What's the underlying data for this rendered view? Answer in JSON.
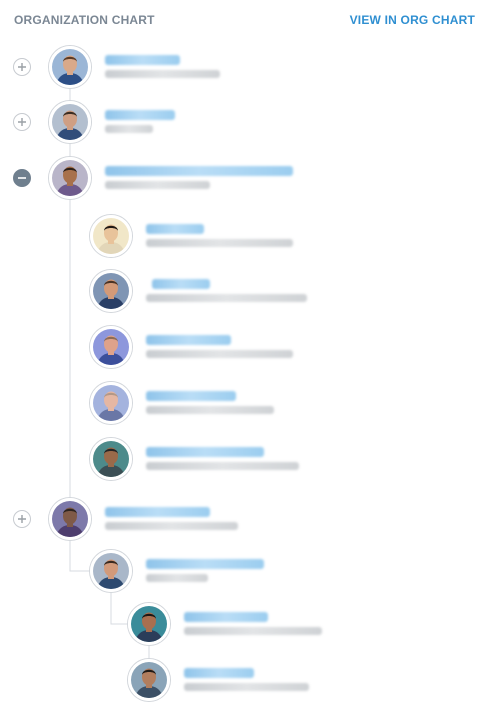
{
  "header": {
    "title": "ORGANIZATION CHART",
    "view_link": "VIEW IN ORG CHART"
  },
  "colors": {
    "accent": "#2f8fd1",
    "muted_text": "#7b8794",
    "connector": "#d7dbe0",
    "collapse_toggle": "#6f7f8e"
  },
  "people": [
    {
      "name": "",
      "title": "",
      "toggle": "plus",
      "skin": "#d9a98a",
      "shirt": "#2d4f86",
      "hair": "#5a3b27",
      "bg": "#9bb6d6"
    },
    {
      "name": "",
      "title": "",
      "toggle": "plus",
      "skin": "#cf9f84",
      "shirt": "#314d7a",
      "hair": "#3b2d22",
      "bg": "#b3bfcf"
    },
    {
      "name": "",
      "title": "",
      "toggle": "minus",
      "skin": "#a8714c",
      "shirt": "#6e5a8c",
      "hair": "#2c1f18",
      "bg": "#b9b5c9"
    },
    {
      "name": "",
      "title": "",
      "toggle": "",
      "skin": "#e8c39a",
      "shirt": "#e2d6b8",
      "hair": "#1f1914",
      "bg": "#f1e7c8"
    },
    {
      "name": "",
      "title": "",
      "toggle": "",
      "skin": "#d39a78",
      "shirt": "#2a3f66",
      "hair": "#4a3426",
      "bg": "#7f95b4"
    },
    {
      "name": "",
      "title": "",
      "toggle": "",
      "skin": "#dfa28a",
      "shirt": "#3c4f9b",
      "hair": "#8d6c56",
      "bg": "#8d97dc"
    },
    {
      "name": "",
      "title": "",
      "toggle": "",
      "skin": "#e5b7a3",
      "shirt": "#6a77a6",
      "hair": "#b49886",
      "bg": "#a4b3de"
    },
    {
      "name": "",
      "title": "",
      "toggle": "",
      "skin": "#9a6a4a",
      "shirt": "#3b4f55",
      "hair": "#252525",
      "bg": "#4d8b8b"
    },
    {
      "name": "",
      "title": "",
      "toggle": "plus",
      "skin": "#7f5a48",
      "shirt": "#4e3e6e",
      "hair": "#2d2420",
      "bg": "#7d79aa"
    },
    {
      "name": "",
      "title": "",
      "toggle": "",
      "skin": "#d29a7a",
      "shirt": "#2e4a70",
      "hair": "#3a2a20",
      "bg": "#a9b7c9"
    },
    {
      "name": "",
      "title": "",
      "toggle": "",
      "skin": "#a96f4f",
      "shirt": "#2b3d5a",
      "hair": "#1d1714",
      "bg": "#3a8c9a"
    },
    {
      "name": "",
      "title": "",
      "toggle": "",
      "skin": "#b27e5e",
      "shirt": "#3c5066",
      "hair": "#201a16",
      "bg": "#8aa4b8"
    }
  ]
}
